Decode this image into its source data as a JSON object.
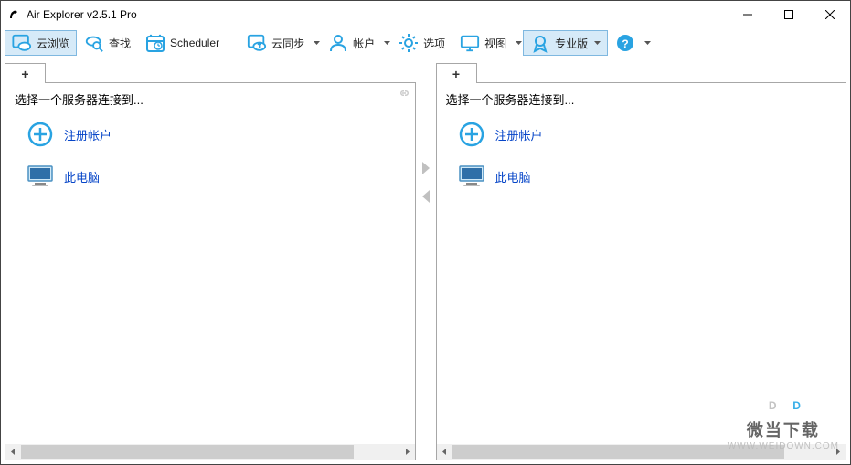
{
  "window": {
    "title": "Air Explorer v2.5.1 Pro"
  },
  "toolbar": {
    "cloudbrowse": "云浏览",
    "search": "查找",
    "scheduler": "Scheduler",
    "sync": "云同步",
    "accounts": "帐户",
    "options": "选项",
    "view": "视图",
    "pro": "专业版"
  },
  "panes": {
    "left": {
      "prompt": "选择一个服务器连接到...",
      "register": "注册帐户",
      "thispc": "此电脑"
    },
    "right": {
      "prompt": "选择一个服务器连接到...",
      "register": "注册帐户",
      "thispc": "此电脑"
    }
  },
  "watermark": {
    "line1": "微当下载",
    "line2": "WWW.WEIDOWN.COM"
  }
}
